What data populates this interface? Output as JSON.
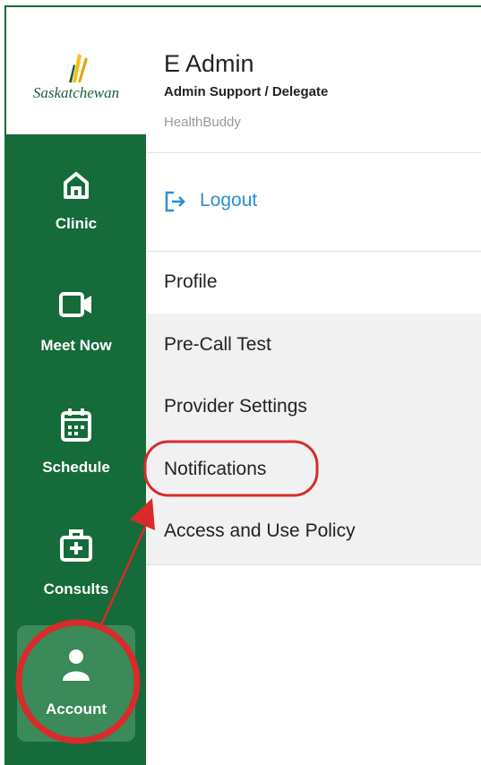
{
  "brand": {
    "logo_text": "Saskatchewan"
  },
  "sidebar": {
    "items": [
      {
        "label": "Clinic",
        "icon": "home-icon"
      },
      {
        "label": "Meet Now",
        "icon": "video-camera-icon"
      },
      {
        "label": "Schedule",
        "icon": "calendar-icon"
      },
      {
        "label": "Consults",
        "icon": "medical-kit-icon"
      },
      {
        "label": "Account",
        "icon": "user-icon",
        "active": true
      }
    ]
  },
  "account": {
    "name": "E Admin",
    "role": "Admin Support / Delegate",
    "app": "HealthBuddy",
    "logout_label": "Logout"
  },
  "menu": {
    "items": [
      {
        "label": "Profile",
        "active": true
      },
      {
        "label": "Pre-Call Test"
      },
      {
        "label": "Provider Settings"
      },
      {
        "label": "Notifications",
        "highlighted": true
      },
      {
        "label": "Access and Use Policy"
      }
    ]
  },
  "colors": {
    "sidebar": "#156b3a",
    "sidebar_active": "#3a8a5a",
    "link": "#2a8fd6",
    "annotation": "#d92b2b",
    "menu_bg": "#f1f1f1"
  }
}
